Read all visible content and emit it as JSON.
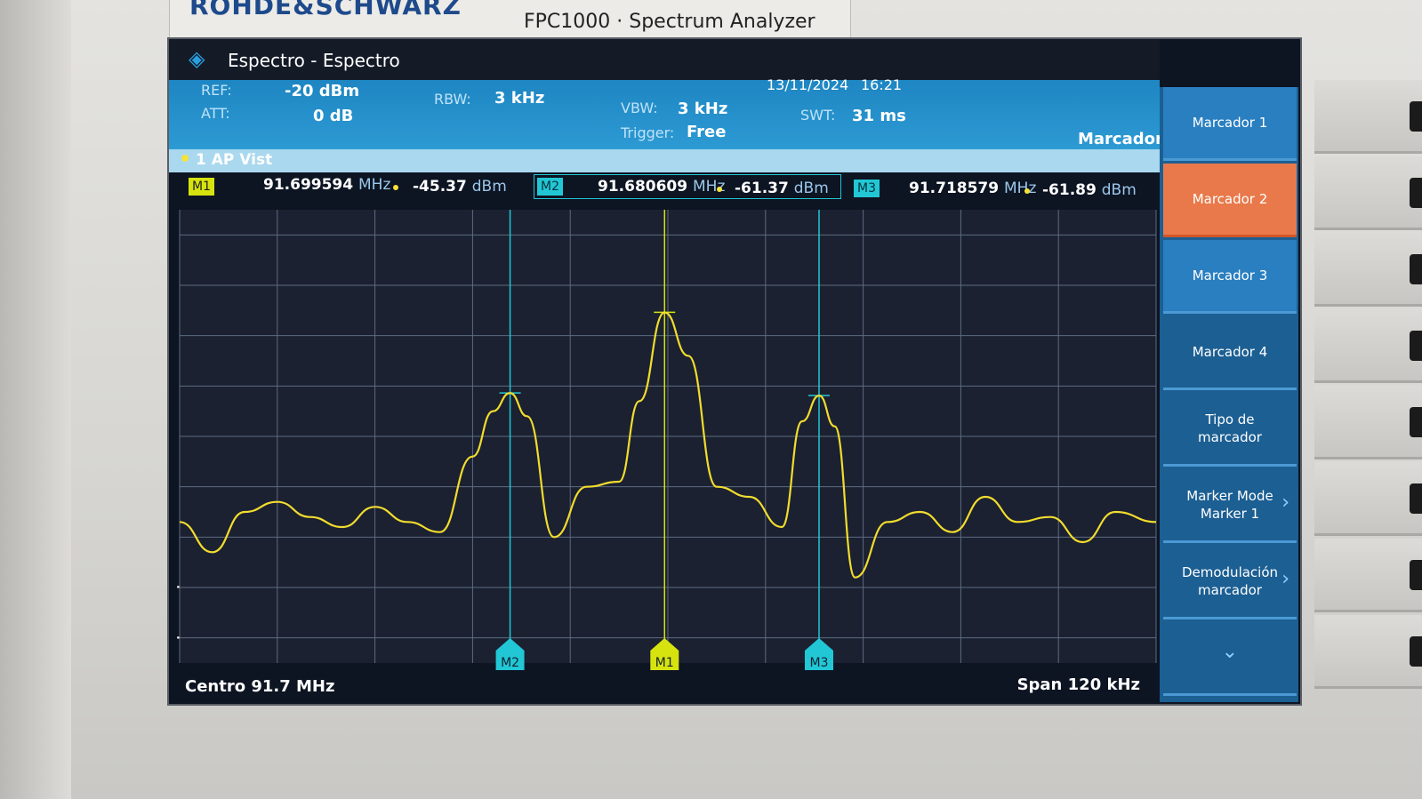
{
  "device": {
    "brand": "ROHDE&SCHWARZ",
    "model": "FPC1000 · Spectrum Analyzer"
  },
  "screen": {
    "title": "Espectro - Espectro",
    "date": "13/11/2024",
    "time": "16:21",
    "ref_label": "REF:",
    "ref_value": "-20 dBm",
    "att_label": "ATT:",
    "att_value": "0 dB",
    "rbw_label": "RBW:",
    "rbw_value": "3 kHz",
    "vbw_label": "VBW:",
    "vbw_value": "3 kHz",
    "swt_label": "SWT:",
    "swt_value": "31 ms",
    "trigger_label": "Trigger:",
    "trigger_value": "Free",
    "trace_status": "1 AP  Vist",
    "panel_title": "Marcador",
    "m2_input_label": "M2",
    "m2_input_value": "91.680609 MHz"
  },
  "markers": {
    "m1": {
      "tag": "M1",
      "freq": "91.699594",
      "freq_unit": "MHz",
      "level": "-45.37",
      "level_unit": "dBm"
    },
    "m2": {
      "tag": "M2",
      "freq": "91.680609",
      "freq_unit": "MHz",
      "level": "-61.37",
      "level_unit": "dBm"
    },
    "m3": {
      "tag": "M3",
      "freq": "91.718579",
      "freq_unit": "MHz",
      "level": "-61.89",
      "level_unit": "dBm"
    }
  },
  "footer": {
    "center": "Centro 91.7 MHz",
    "span": "Span 120 kHz"
  },
  "softkeys": [
    {
      "label": "Marcador 1",
      "chevron": ""
    },
    {
      "label": "Marcador 2",
      "chevron": ""
    },
    {
      "label": "Marcador 3",
      "chevron": ""
    },
    {
      "label": "Marcador 4",
      "chevron": ""
    },
    {
      "label": "Tipo de marcador",
      "chevron": ""
    },
    {
      "label": "Marker Mode Marker 1",
      "chevron": "›"
    },
    {
      "label": "Demodulación marcador",
      "chevron": "›"
    },
    {
      "label": "",
      "chevron": "⌄"
    }
  ],
  "chart_data": {
    "type": "line",
    "x_unit": "MHz",
    "y_unit": "dBm",
    "x_center": 91.7,
    "x_span_khz": 120,
    "ylim": [
      -115,
      -25
    ],
    "y_ticks": [
      "-30.0",
      "-40.0",
      "-50.0",
      "-60.0",
      "-70.0",
      "-80.0",
      "-90.0",
      "-100.0",
      "-110.0"
    ],
    "grid": true,
    "series": [
      {
        "color": "#f2dc2e",
        "x": [
          91.64,
          91.644,
          91.648,
          91.652,
          91.656,
          91.66,
          91.664,
          91.668,
          91.672,
          91.676,
          91.6785,
          91.6806,
          91.6827,
          91.686,
          91.69,
          91.694,
          91.6965,
          91.6996,
          91.7025,
          91.706,
          91.71,
          91.714,
          91.7165,
          91.7186,
          91.7205,
          91.723,
          91.727,
          91.731,
          91.735,
          91.739,
          91.743,
          91.747,
          91.751,
          91.755,
          91.76
        ],
        "y": [
          -87,
          -93,
          -85,
          -83,
          -86,
          -88,
          -84,
          -87,
          -89,
          -74,
          -65,
          -61.4,
          -66,
          -90,
          -80,
          -79,
          -63,
          -45.4,
          -54,
          -80,
          -82,
          -88,
          -67,
          -61.9,
          -68,
          -98,
          -87,
          -85,
          -89,
          -82,
          -87,
          -86,
          -91,
          -85,
          -87
        ]
      }
    ],
    "markers": [
      {
        "name": "M1",
        "x": 91.699594,
        "y": -45.37
      },
      {
        "name": "M2",
        "x": 91.680609,
        "y": -61.37
      },
      {
        "name": "M3",
        "x": 91.718579,
        "y": -61.89
      }
    ]
  },
  "colors": {
    "trace": "#f2dc2e",
    "marker_m1": "#d7e30e",
    "marker_m2_m3": "#22c7d5",
    "active_softkey": "#e9794a",
    "info_bar": "#1e86c2"
  }
}
